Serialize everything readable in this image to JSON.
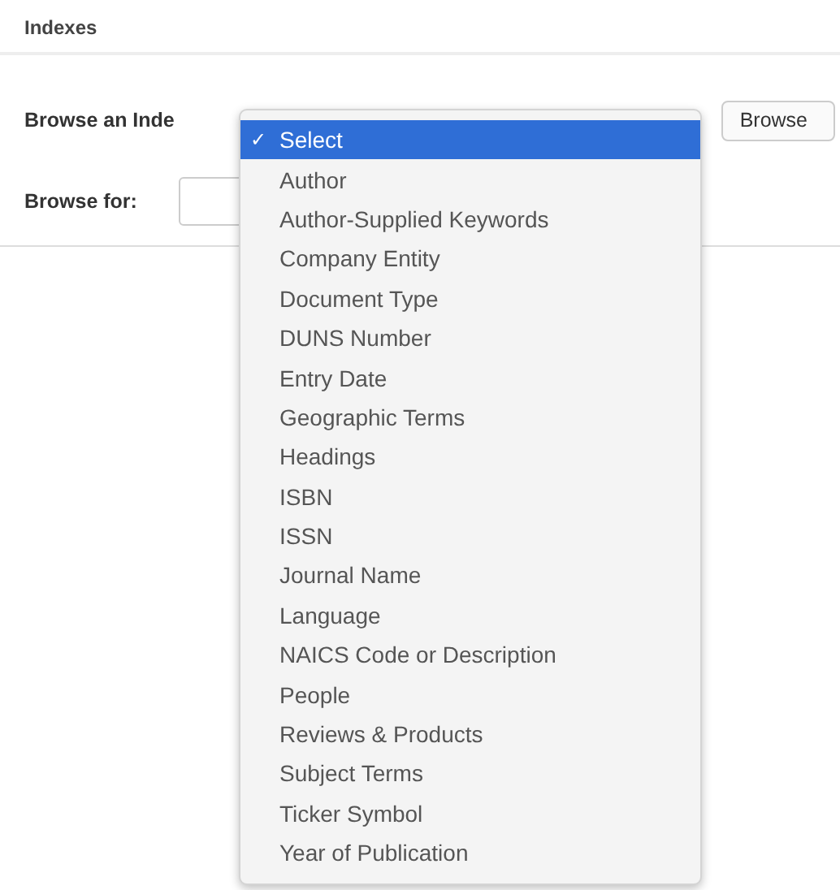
{
  "heading": "Indexes",
  "browse_index": {
    "label": "Browse an Inde",
    "button": "Browse"
  },
  "browse_for": {
    "label": "Browse for:"
  },
  "dropdown_menu": {
    "options": [
      {
        "label": "Select",
        "selected": true
      },
      {
        "label": "Author",
        "selected": false
      },
      {
        "label": "Author-Supplied Keywords",
        "selected": false
      },
      {
        "label": "Company Entity",
        "selected": false
      },
      {
        "label": "Document Type",
        "selected": false
      },
      {
        "label": "DUNS Number",
        "selected": false
      },
      {
        "label": "Entry Date",
        "selected": false
      },
      {
        "label": "Geographic Terms",
        "selected": false
      },
      {
        "label": "Headings",
        "selected": false
      },
      {
        "label": "ISBN",
        "selected": false
      },
      {
        "label": "ISSN",
        "selected": false
      },
      {
        "label": "Journal Name",
        "selected": false
      },
      {
        "label": "Language",
        "selected": false
      },
      {
        "label": "NAICS Code or Description",
        "selected": false
      },
      {
        "label": "People",
        "selected": false
      },
      {
        "label": "Reviews & Products",
        "selected": false
      },
      {
        "label": "Subject Terms",
        "selected": false
      },
      {
        "label": "Ticker Symbol",
        "selected": false
      },
      {
        "label": "Year of Publication",
        "selected": false
      }
    ],
    "check": "✓"
  }
}
